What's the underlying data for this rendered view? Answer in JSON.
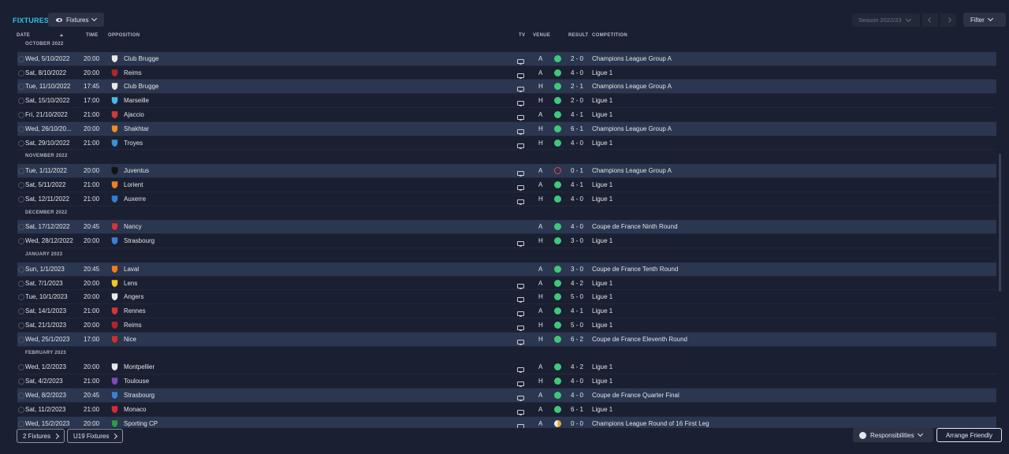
{
  "header": {
    "title": "FIXTURES",
    "view_label": "Fixtures",
    "season_label": "Season 2022/23",
    "filter_label": "Filter"
  },
  "columns": {
    "date": "DATE",
    "time": "TIME",
    "opposition": "OPPOSITION",
    "tv": "TV",
    "venue": "VENUE",
    "result": "RESULT",
    "competition": "COMPETITION"
  },
  "colors": {
    "win": "#3ec97a",
    "loss": "#e0444f",
    "draw": "#f0a23a",
    "accent": "#2ec6e0",
    "row_highlight": "#2b3750"
  },
  "months": [
    {
      "label": "OCTOBER 2022",
      "fixtures": [
        {
          "date": "Wed, 5/10/2022",
          "time": "20:00",
          "opponent": "Club Brugge",
          "crest": "#e8e8e8",
          "tv": true,
          "venue": "A",
          "outcome": "win",
          "result": "2 - 0",
          "competition": "Champions League Group A",
          "highlight": true
        },
        {
          "date": "Sat, 8/10/2022",
          "time": "20:00",
          "opponent": "Reims",
          "crest": "#b5222e",
          "tv": true,
          "venue": "A",
          "outcome": "win",
          "result": "4 - 0",
          "competition": "Ligue 1",
          "highlight": false
        },
        {
          "date": "Tue, 11/10/2022",
          "time": "17:45",
          "opponent": "Club Brugge",
          "crest": "#e8e8e8",
          "tv": true,
          "venue": "H",
          "outcome": "win",
          "result": "2 - 1",
          "competition": "Champions League Group A",
          "highlight": true
        },
        {
          "date": "Sat, 15/10/2022",
          "time": "17:00",
          "opponent": "Marseille",
          "crest": "#49b6e8",
          "tv": true,
          "venue": "H",
          "outcome": "win",
          "result": "2 - 0",
          "competition": "Ligue 1",
          "highlight": false
        },
        {
          "date": "Fri, 21/10/2022",
          "time": "21:00",
          "opponent": "Ajaccio",
          "crest": "#d23a3a",
          "tv": true,
          "venue": "A",
          "outcome": "win",
          "result": "4 - 1",
          "competition": "Ligue 1",
          "highlight": false
        },
        {
          "date": "Wed, 26/10/20...",
          "time": "20:00",
          "opponent": "Shakhtar",
          "crest": "#f08a24",
          "tv": true,
          "venue": "H",
          "outcome": "win",
          "result": "6 - 1",
          "competition": "Champions League Group A",
          "highlight": true
        },
        {
          "date": "Sat, 29/10/2022",
          "time": "21:00",
          "opponent": "Troyes",
          "crest": "#3f8fd2",
          "tv": true,
          "venue": "H",
          "outcome": "win",
          "result": "4 - 0",
          "competition": "Ligue 1",
          "highlight": false
        }
      ]
    },
    {
      "label": "NOVEMBER 2022",
      "fixtures": [
        {
          "date": "Tue, 1/11/2022",
          "time": "20:00",
          "opponent": "Juventus",
          "crest": "#111111",
          "tv": true,
          "venue": "A",
          "outcome": "loss",
          "result": "0 - 1",
          "competition": "Champions League Group A",
          "highlight": true
        },
        {
          "date": "Sat, 5/11/2022",
          "time": "21:00",
          "opponent": "Lorient",
          "crest": "#ef7d22",
          "tv": true,
          "venue": "A",
          "outcome": "win",
          "result": "4 - 1",
          "competition": "Ligue 1",
          "highlight": false
        },
        {
          "date": "Sat, 12/11/2022",
          "time": "21:00",
          "opponent": "Auxerre",
          "crest": "#2f7fd0",
          "tv": true,
          "venue": "H",
          "outcome": "win",
          "result": "4 - 0",
          "competition": "Ligue 1",
          "highlight": false
        }
      ]
    },
    {
      "label": "DECEMBER 2022",
      "fixtures": [
        {
          "date": "Sat, 17/12/2022",
          "time": "20:45",
          "opponent": "Nancy",
          "crest": "#d8343a",
          "tv": false,
          "venue": "A",
          "outcome": "win",
          "result": "4 - 0",
          "competition": "Coupe de France Ninth Round",
          "highlight": true
        },
        {
          "date": "Wed, 28/12/2022",
          "time": "20:00",
          "opponent": "Strasbourg",
          "crest": "#3b7fd6",
          "tv": true,
          "venue": "H",
          "outcome": "win",
          "result": "3 - 0",
          "competition": "Ligue 1",
          "highlight": false
        }
      ]
    },
    {
      "label": "JANUARY 2023",
      "fixtures": [
        {
          "date": "Sun, 1/1/2023",
          "time": "20:45",
          "opponent": "Laval",
          "crest": "#ef7c24",
          "tv": false,
          "venue": "A",
          "outcome": "win",
          "result": "3 - 0",
          "competition": "Coupe de France Tenth Round",
          "highlight": true
        },
        {
          "date": "Sat, 7/1/2023",
          "time": "20:00",
          "opponent": "Lens",
          "crest": "#f2c81f",
          "tv": true,
          "venue": "A",
          "outcome": "win",
          "result": "4 - 2",
          "competition": "Ligue 1",
          "highlight": false
        },
        {
          "date": "Tue, 10/1/2023",
          "time": "20:00",
          "opponent": "Angers",
          "crest": "#e9e9e9",
          "tv": true,
          "venue": "H",
          "outcome": "win",
          "result": "5 - 0",
          "competition": "Ligue 1",
          "highlight": false
        },
        {
          "date": "Sat, 14/1/2023",
          "time": "21:00",
          "opponent": "Rennes",
          "crest": "#d63333",
          "tv": true,
          "venue": "A",
          "outcome": "win",
          "result": "4 - 1",
          "competition": "Ligue 1",
          "highlight": false
        },
        {
          "date": "Sat, 21/1/2023",
          "time": "20:00",
          "opponent": "Reims",
          "crest": "#b5222e",
          "tv": true,
          "venue": "H",
          "outcome": "win",
          "result": "5 - 0",
          "competition": "Ligue 1",
          "highlight": false
        },
        {
          "date": "Wed, 25/1/2023",
          "time": "17:00",
          "opponent": "Nice",
          "crest": "#c8342e",
          "tv": true,
          "venue": "H",
          "outcome": "win",
          "result": "6 - 2",
          "competition": "Coupe de France Eleventh Round",
          "highlight": true
        }
      ]
    },
    {
      "label": "FEBRUARY 2023",
      "fixtures": [
        {
          "date": "Wed, 1/2/2023",
          "time": "20:00",
          "opponent": "Montpellier",
          "crest": "#e8e8e8",
          "tv": true,
          "venue": "A",
          "outcome": "win",
          "result": "4 - 2",
          "competition": "Ligue 1",
          "highlight": false
        },
        {
          "date": "Sat, 4/2/2023",
          "time": "21:00",
          "opponent": "Toulouse",
          "crest": "#7b4bb8",
          "tv": true,
          "venue": "H",
          "outcome": "win",
          "result": "4 - 0",
          "competition": "Ligue 1",
          "highlight": false
        },
        {
          "date": "Wed, 8/2/2023",
          "time": "20:45",
          "opponent": "Strasbourg",
          "crest": "#3b7fd6",
          "tv": true,
          "venue": "A",
          "outcome": "win",
          "result": "4 - 0",
          "competition": "Coupe de France Quarter Final",
          "highlight": true
        },
        {
          "date": "Sat, 11/2/2023",
          "time": "21:00",
          "opponent": "Monaco",
          "crest": "#d52a36",
          "tv": true,
          "venue": "A",
          "outcome": "win",
          "result": "6 - 1",
          "competition": "Ligue 1",
          "highlight": false
        },
        {
          "date": "Wed, 15/2/2023",
          "time": "20:00",
          "opponent": "Sporting CP",
          "crest": "#2e9a4a",
          "tv": true,
          "venue": "A",
          "outcome": "draw",
          "result": "0 - 0",
          "competition": "Champions League Round of 16 First Leg",
          "highlight": true
        }
      ]
    }
  ],
  "footer": {
    "link_1": "2 Fixtures",
    "link_2": "U19 Fixtures",
    "responsibilities": "Responsibilities",
    "arrange": "Arrange Friendly"
  }
}
